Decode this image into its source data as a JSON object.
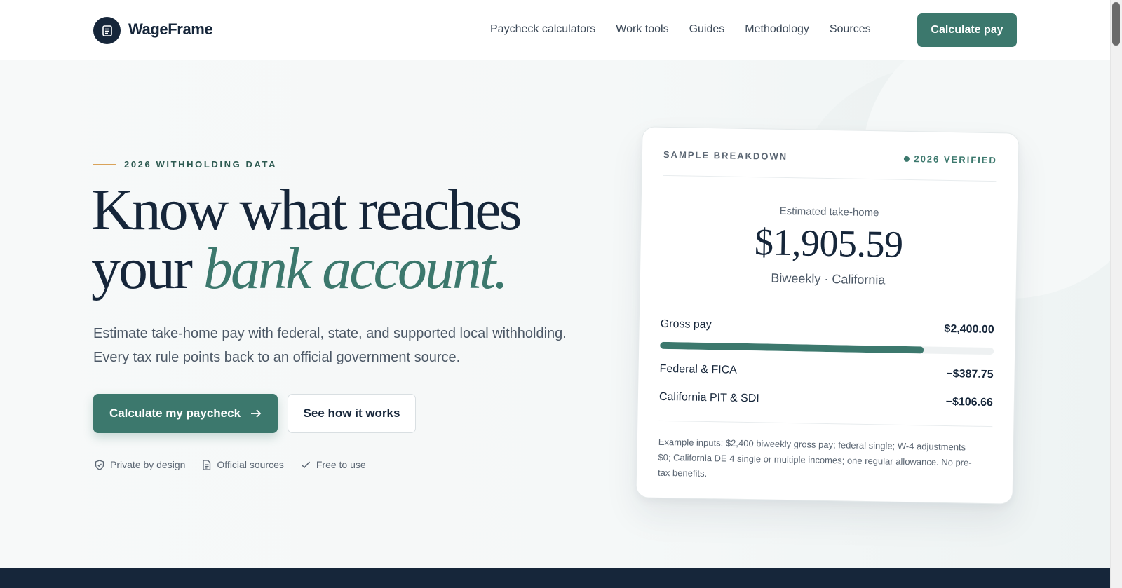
{
  "brand": {
    "name": "WageFrame"
  },
  "nav": {
    "items": [
      "Paycheck calculators",
      "Work tools",
      "Guides",
      "Methodology",
      "Sources"
    ],
    "cta_label": "Calculate pay"
  },
  "hero": {
    "eyebrow": "2026 WITHHOLDING DATA",
    "headline_line1": "Know what reaches",
    "headline_line2_plain": "your ",
    "headline_line2_accent": "bank account.",
    "subtext": "Estimate take-home pay with federal, state, and supported local withholding. Every tax rule points back to an official government source.",
    "primary_button": "Calculate my paycheck",
    "secondary_button": "See how it works",
    "trust": [
      {
        "label": "Private by design",
        "icon": "shield-check-icon"
      },
      {
        "label": "Official sources",
        "icon": "document-icon"
      },
      {
        "label": "Free to use",
        "icon": "check-icon"
      }
    ]
  },
  "card": {
    "label": "SAMPLE BREAKDOWN",
    "verified": "2026 VERIFIED",
    "take_home_label": "Estimated take-home",
    "take_home_amount": "$1,905.59",
    "take_home_sub": "Biweekly · California",
    "gross_label": "Gross pay",
    "gross_value": "$2,400.00",
    "gross_bar_fraction": 0.79,
    "rows": [
      {
        "label": "Federal & FICA",
        "value": "−$387.75"
      },
      {
        "label": "California PIT & SDI",
        "value": "−$106.66"
      }
    ],
    "note": "Example inputs: $2,400 biweekly gross pay; federal single; W-4 adjustments $0; California DE 4 single or multiple incomes; one regular allowance. No pre-tax benefits."
  },
  "colors": {
    "accent": "#3c786d",
    "navy": "#16263a",
    "eyebrow_line": "#d9a35a"
  }
}
